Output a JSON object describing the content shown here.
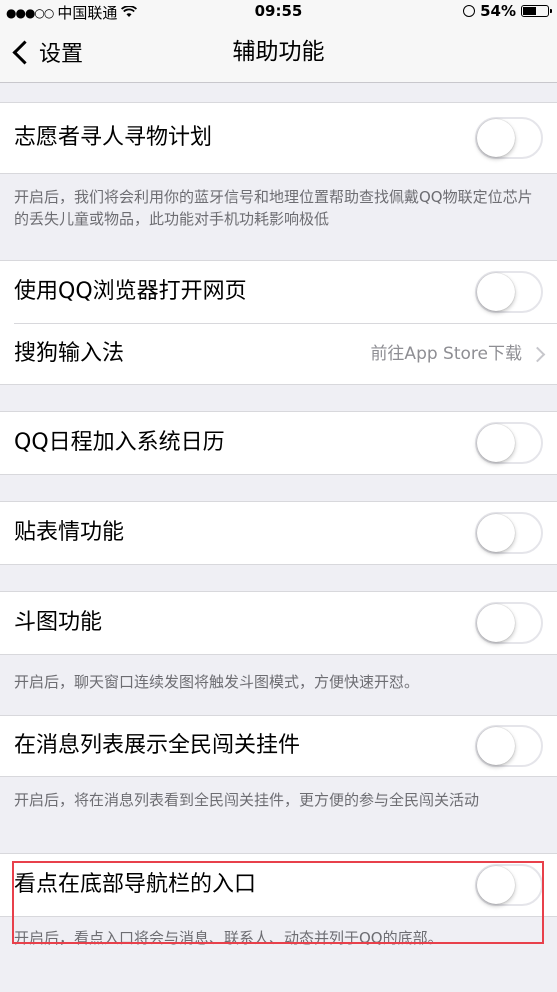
{
  "status_bar": {
    "signal": "●●●○○",
    "carrier": "中国联通",
    "wifi_icon": "wifi-icon",
    "time": "09:55",
    "battery_percent": "54%",
    "battery_level": 0.54
  },
  "nav": {
    "back_label": "设置",
    "title": "辅助功能"
  },
  "items": {
    "volunteer": {
      "label": "志愿者寻人寻物计划",
      "enabled": false,
      "desc": "开启后，我们将会利用你的蓝牙信号和地理位置帮助查找佩戴QQ物联定位芯片的丢失儿童或物品，此功能对手机功耗影响极低"
    },
    "qq_browser": {
      "label": "使用QQ浏览器打开网页",
      "enabled": false
    },
    "sogou": {
      "label": "搜狗输入法",
      "detail": "前往App Store下载"
    },
    "calendar": {
      "label": "QQ日程加入系统日历",
      "enabled": false
    },
    "sticker": {
      "label": "贴表情功能",
      "enabled": false
    },
    "doutu": {
      "label": "斗图功能",
      "enabled": false,
      "desc": "开启后，聊天窗口连续发图将触发斗图模式，方便快速开怼。"
    },
    "game_widget": {
      "label": "在消息列表展示全民闯关挂件",
      "enabled": false,
      "desc": "开启后，将在消息列表看到全民闯关挂件，更方便的参与全民闯关活动"
    },
    "kandian": {
      "label": "看点在底部导航栏的入口",
      "enabled": false,
      "desc": "开启后，看点入口将会与消息、联系人、动态并列于QQ的底部。"
    }
  },
  "colors": {
    "background": "#efeff4",
    "highlight": "#e8404b"
  }
}
